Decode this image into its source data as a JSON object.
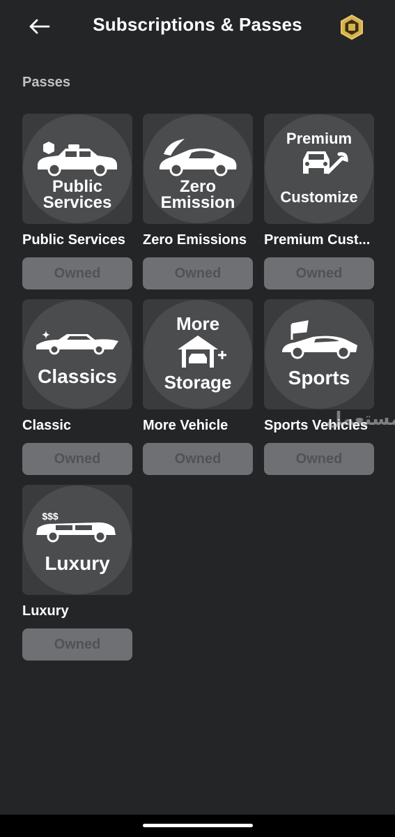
{
  "header": {
    "title": "Subscriptions & Passes",
    "back_icon": "arrow-left-icon",
    "currency_icon": "robux-icon",
    "currency_color": "#d6b24c"
  },
  "section": {
    "label": "Passes"
  },
  "passes": [
    {
      "name": "Public Services",
      "icon_lines": [
        "Public",
        "Services"
      ],
      "icon": "police-car-icon",
      "button": "Owned"
    },
    {
      "name": "Zero Emissions",
      "icon_lines": [
        "Zero",
        "Emission"
      ],
      "icon": "electric-car-icon",
      "button": "Owned"
    },
    {
      "name": "Premium Cust...",
      "icon_lines": [
        "Premium",
        "Customize"
      ],
      "icon": "car-wrench-icon",
      "button": "Owned"
    },
    {
      "name": "Classic",
      "icon_lines": [
        "Classics"
      ],
      "icon": "classic-car-icon",
      "button": "Owned"
    },
    {
      "name": "More Vehicle",
      "icon_lines": [
        "More",
        "Storage"
      ],
      "icon": "garage-icon",
      "button": "Owned"
    },
    {
      "name": "Sports Vehicles",
      "icon_lines": [
        "Sports"
      ],
      "icon": "sports-car-icon",
      "button": "Owned"
    },
    {
      "name": "Luxury",
      "icon_lines": [
        "$$$",
        "Luxury"
      ],
      "icon": "limousine-icon",
      "button": "Owned"
    }
  ],
  "watermark": "مستعمل",
  "colors": {
    "background": "#232527",
    "button": "#6e7073",
    "button_text": "#505254",
    "tile": "#393b3d"
  }
}
